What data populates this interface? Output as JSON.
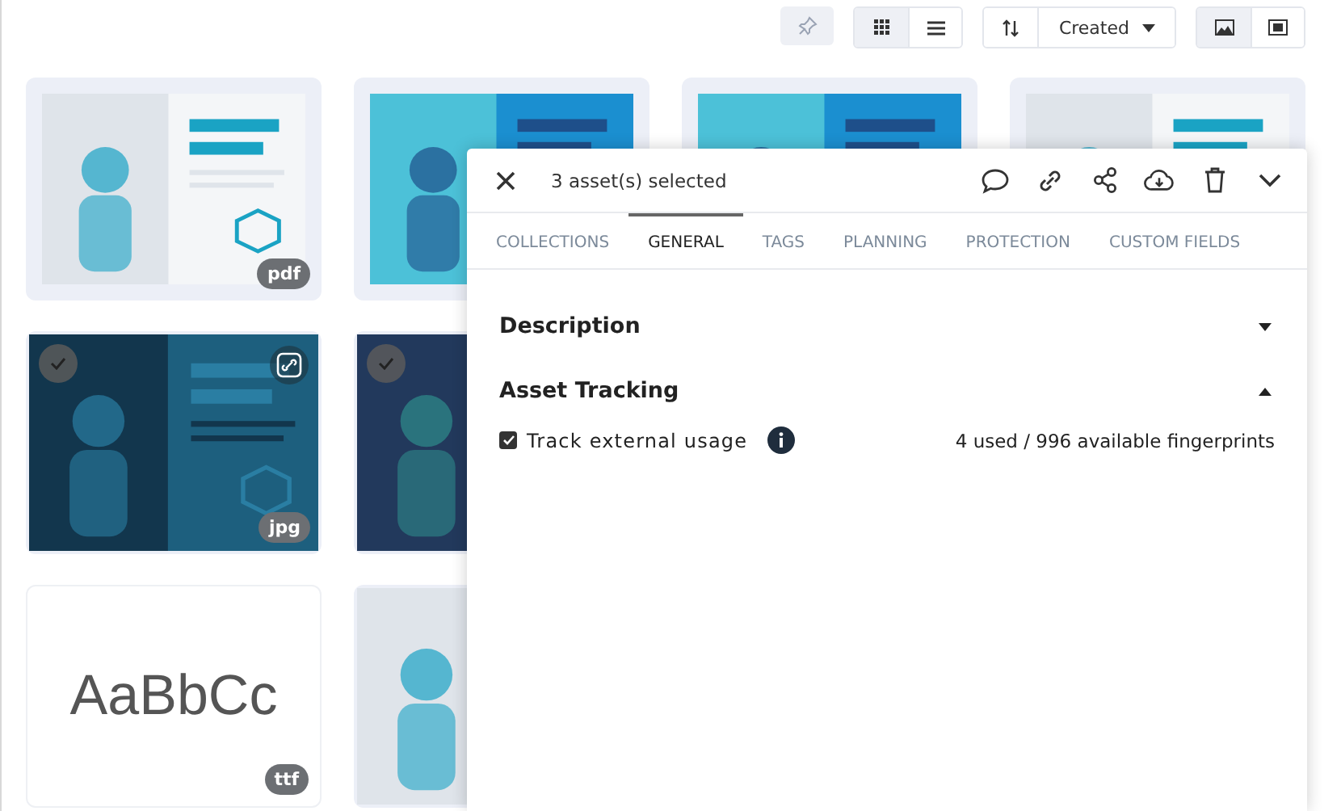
{
  "toolbar": {
    "pin": {
      "disabled": true
    },
    "view_modes": [
      {
        "selected": true
      },
      {
        "selected": false
      }
    ],
    "sort": {
      "label": "Created"
    },
    "preview_modes": [
      {
        "selected": true
      },
      {
        "selected": false
      }
    ]
  },
  "rows": [
    {
      "cards": [
        {
          "kind": "picture",
          "badge": "pdf",
          "selected": false
        },
        {
          "kind": "picture",
          "selected": false
        },
        {
          "kind": "picture",
          "selected": false
        },
        {
          "kind": "picture",
          "selected": false
        }
      ]
    },
    {
      "cards": [
        {
          "kind": "picture",
          "badge": "jpg",
          "selected": true,
          "linked": true
        },
        {
          "kind": "picture",
          "selected": true,
          "linked": false
        }
      ]
    },
    {
      "cards": [
        {
          "kind": "font",
          "sample": "AaBbCc",
          "badge": "ttf",
          "selected": false
        },
        {
          "kind": "picture",
          "selected": false
        }
      ]
    }
  ],
  "panel": {
    "title": "3 asset(s) selected",
    "tabs": [
      {
        "label": "COLLECTIONS",
        "selected": false
      },
      {
        "label": "GENERAL",
        "selected": true
      },
      {
        "label": "TAGS",
        "selected": false
      },
      {
        "label": "PLANNING",
        "selected": false
      },
      {
        "label": "PROTECTION",
        "selected": false
      },
      {
        "label": "CUSTOM FIELDS",
        "selected": false
      }
    ],
    "sections": [
      {
        "title": "Description",
        "expanded": false
      },
      {
        "title": "Asset Tracking",
        "expanded": true,
        "option": {
          "label": "Track external usage",
          "checked": true
        },
        "usage": "4 used / 996 available fingerprints"
      }
    ]
  }
}
